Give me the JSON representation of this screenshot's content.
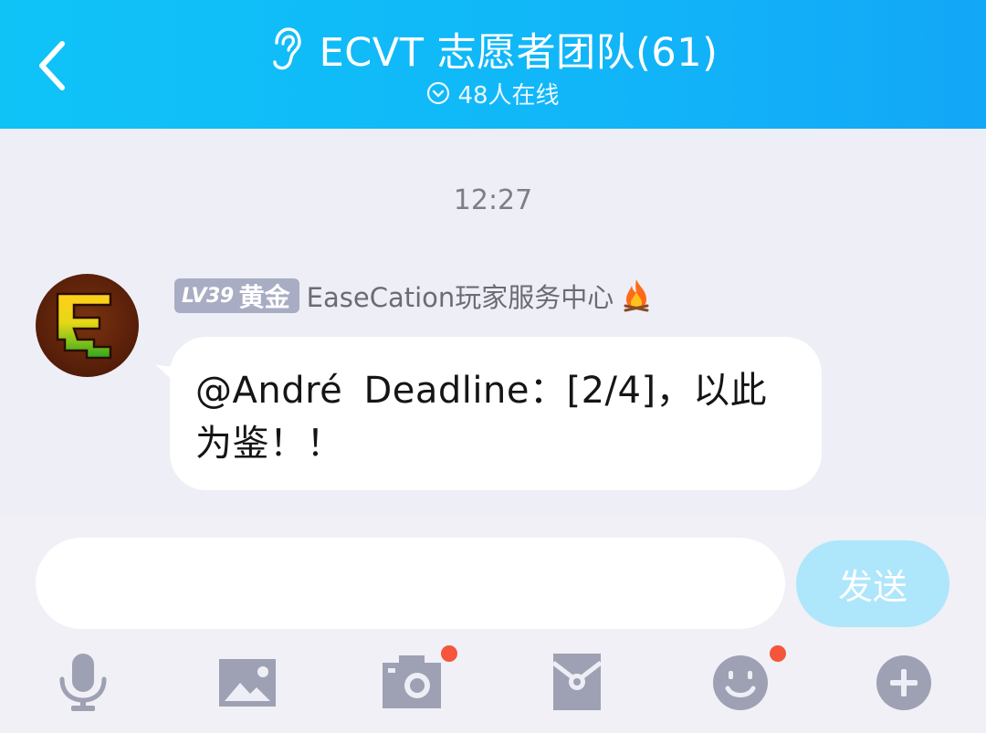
{
  "header": {
    "title": "ECVT 志愿者团队(61)",
    "online_status": "48人在线",
    "background_color": "#11b6f8"
  },
  "chat": {
    "timestamp": "12:27",
    "messages": [
      {
        "badge_level": "LV39",
        "badge_title": "黄金",
        "sender_name": "EaseCation玩家服务中心",
        "text": "@André Deadline：[2/4]，以此为鉴！！"
      }
    ]
  },
  "composer": {
    "input_value": "",
    "send_label": "发送"
  },
  "toolbar": {
    "items": [
      {
        "icon": "microphone-icon"
      },
      {
        "icon": "image-icon"
      },
      {
        "icon": "camera-icon",
        "notification": true
      },
      {
        "icon": "red-packet-icon"
      },
      {
        "icon": "emoji-icon",
        "notification": true
      },
      {
        "icon": "plus-icon"
      }
    ]
  },
  "colors": {
    "accent": "#11b6f8",
    "send_button": "#aee6fb",
    "icon_gray": "#9ea1b3",
    "notification": "#f5553a"
  }
}
